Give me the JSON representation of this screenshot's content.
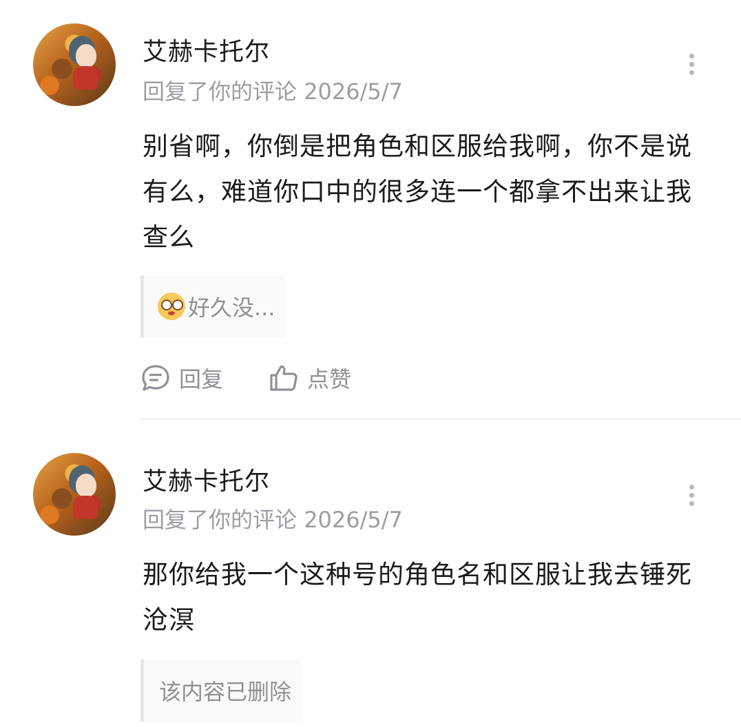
{
  "comments": [
    {
      "username": "艾赫卡托尔",
      "action_text": "回复了你的评论",
      "date": "2026/5/7",
      "body": "别省啊，你倒是把角色和区服给我啊，你不是说有么，难道你口中的很多连一个都拿不出来让我查么",
      "quote": "好久没...",
      "quote_icon": "dizzy-face-emoji"
    },
    {
      "username": "艾赫卡托尔",
      "action_text": "回复了你的评论",
      "date": "2026/5/7",
      "body": "那你给我一个这种号的角色名和区服让我去锤死沧溟",
      "quote": "该内容已删除"
    }
  ],
  "actions": {
    "reply_label": "回复",
    "like_label": "点赞"
  },
  "icons": {
    "reply": "chat-bubble-icon",
    "like": "thumbs-up-icon",
    "more": "more-vertical-icon"
  },
  "colors": {
    "text_primary": "#1b1b1b",
    "text_secondary": "#9a9ea4",
    "quote_bg": "#fafafa",
    "quote_border": "#e6e6e8",
    "divider": "#ececec"
  }
}
